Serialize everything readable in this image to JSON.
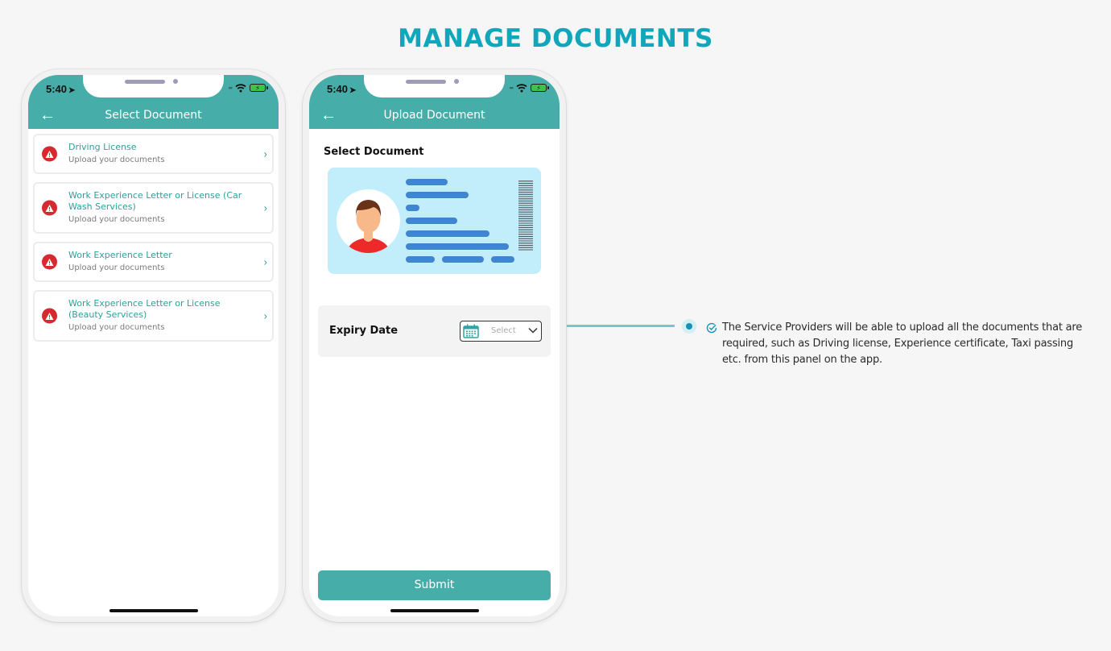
{
  "page": {
    "title": "MANAGE DOCUMENTS",
    "accent_color": "#12a6bb",
    "app_color": "#47ada9"
  },
  "status_bar": {
    "time": "5:40",
    "icons": [
      "location-arrow-icon",
      "signal-icon",
      "wifi-icon",
      "battery-charging-icon"
    ]
  },
  "select_screen": {
    "title": "Select Document",
    "back_icon": "back-arrow-icon",
    "documents": [
      {
        "title": "Driving License",
        "subtitle": "Upload your documents",
        "status_icon": "warning-icon"
      },
      {
        "title": "Work Experience Letter or License (Car Wash Services)",
        "subtitle": "Upload your documents",
        "status_icon": "warning-icon"
      },
      {
        "title": "Work Experience Letter",
        "subtitle": "Upload your documents",
        "status_icon": "warning-icon"
      },
      {
        "title": "Work Experience Letter or License (Beauty Services)",
        "subtitle": "Upload your documents",
        "status_icon": "warning-icon"
      }
    ]
  },
  "upload_screen": {
    "title": "Upload Document",
    "back_icon": "back-arrow-icon",
    "section_label": "Select Document",
    "document_image": "id-card-illustration",
    "expiry": {
      "label": "Expiry Date",
      "placeholder": "Select",
      "icon": "calendar-icon"
    },
    "submit_label": "Submit"
  },
  "callout": {
    "icon": "check-circle-icon",
    "text": "The Service Providers will be able to upload all the documents that are required, such as Driving license, Experience certificate, Taxi passing etc. from this panel on the app."
  }
}
